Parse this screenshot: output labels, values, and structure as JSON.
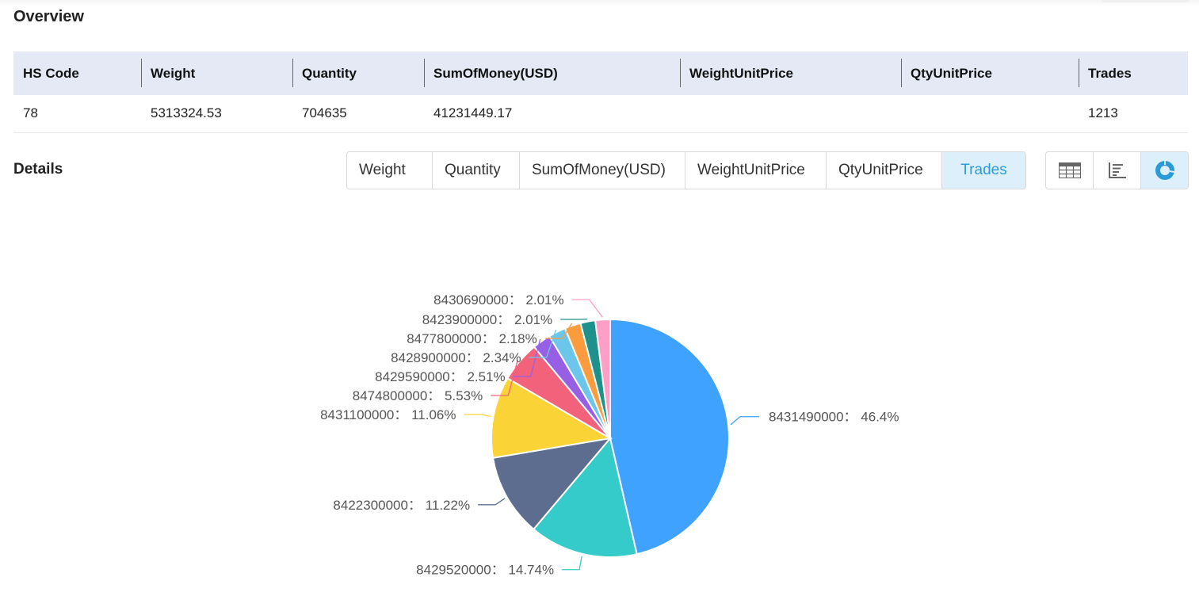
{
  "overview": {
    "title": "Overview",
    "columns": [
      "HS Code",
      "Weight",
      "Quantity",
      "SumOfMoney(USD)",
      "WeightUnitPrice",
      "QtyUnitPrice",
      "Trades"
    ],
    "rows": [
      [
        "78",
        "5313324.53",
        "704635",
        "41231449.17",
        "",
        "",
        "1213"
      ]
    ]
  },
  "details": {
    "title": "Details",
    "metric_tabs": [
      {
        "label": "Weight",
        "active": false
      },
      {
        "label": "Quantity",
        "active": false
      },
      {
        "label": "SumOfMoney(USD)",
        "active": false
      },
      {
        "label": "WeightUnitPrice",
        "active": false
      },
      {
        "label": "QtyUnitPrice",
        "active": false
      },
      {
        "label": "Trades",
        "active": true
      }
    ],
    "view_buttons": [
      {
        "icon": "table-icon",
        "active": false
      },
      {
        "icon": "bar-chart-icon",
        "active": false
      },
      {
        "icon": "pie-chart-icon",
        "active": true
      }
    ],
    "accent_color": "#2a9bd8"
  },
  "chart_data": {
    "type": "pie",
    "title": "",
    "metric": "Trades",
    "label_separator": "：",
    "slices": [
      {
        "name": "8431490000",
        "percent": 46.4,
        "label": "46.4%",
        "color": "#3fa2ff"
      },
      {
        "name": "8429520000",
        "percent": 14.74,
        "label": "14.74%",
        "color": "#36cbcb"
      },
      {
        "name": "8422300000",
        "percent": 11.22,
        "label": "11.22%",
        "color": "#5c6d8f"
      },
      {
        "name": "8431100000",
        "percent": 11.06,
        "label": "11.06%",
        "color": "#fad337"
      },
      {
        "name": "8474800000",
        "percent": 5.53,
        "label": "5.53%",
        "color": "#f2637b"
      },
      {
        "name": "8429590000",
        "percent": 2.51,
        "label": "2.51%",
        "color": "#975fe4"
      },
      {
        "name": "8428900000",
        "percent": 2.34,
        "label": "2.34%",
        "color": "#6ac6ea"
      },
      {
        "name": "8477800000",
        "percent": 2.18,
        "label": "2.18%",
        "color": "#fa9b3e"
      },
      {
        "name": "8423900000",
        "percent": 2.01,
        "label": "2.01%",
        "color": "#1f918c"
      },
      {
        "name": "8430690000",
        "percent": 2.01,
        "label": "2.01%",
        "color": "#ff9fc8"
      }
    ]
  }
}
